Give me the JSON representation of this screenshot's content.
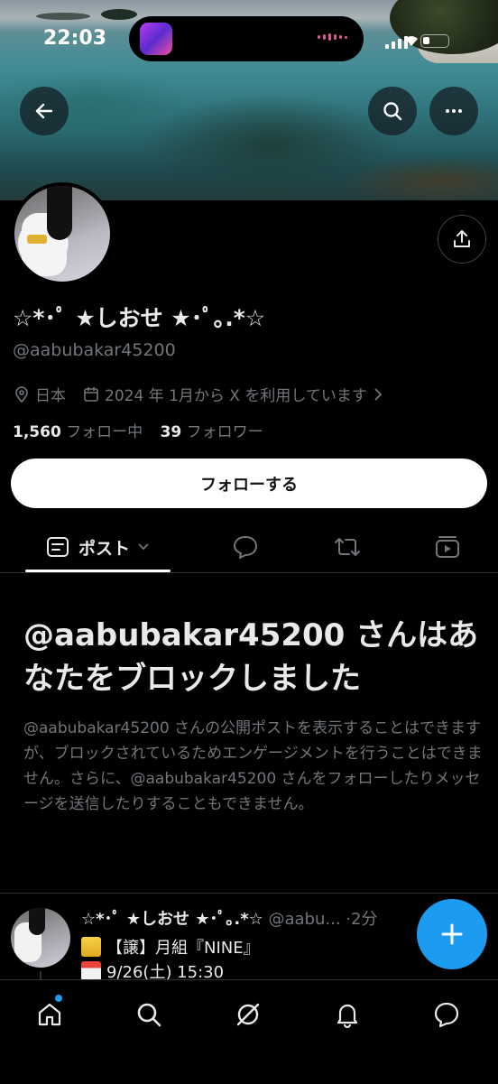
{
  "status_bar": {
    "time": "22:03"
  },
  "profile": {
    "display_name": "☆*･ﾟ ★しおせ ★･ﾟ｡.*☆",
    "handle": "@aabubakar45200",
    "location": "日本",
    "joined": "2024 年 1月から X を利用しています",
    "following_count": "1,560",
    "following_label": "フォロー中",
    "followers_count": "39",
    "followers_label": "フォロワー",
    "follow_button": "フォローする"
  },
  "tabs": [
    {
      "label": "ポスト",
      "icon": "posts-icon",
      "active": true
    },
    {
      "label": "",
      "icon": "reply-icon",
      "active": false
    },
    {
      "label": "",
      "icon": "repost-icon",
      "active": false
    },
    {
      "label": "",
      "icon": "media-icon",
      "active": false
    }
  ],
  "blocked": {
    "title": "@aabubakar45200 さんはあなたをブロックしました",
    "body": "@aabubakar45200 さんの公開ポストを表示することはできますが、ブロックされているためエンゲージメントを行うことはできません。さらに、@aabubakar45200 さんをフォローしたりメッセージを送信したりすることもできません。"
  },
  "post": {
    "author_name": "☆*･ﾟ ★しおせ ★･ﾟ｡.*☆",
    "author_handle": "@aabu...",
    "time": "·2分",
    "line1": "【譲】月組『NINE』",
    "line2": "9/26(土) 15:30"
  },
  "bottom_nav": [
    "home-icon",
    "search-icon",
    "grok-icon",
    "notifications-icon",
    "messages-icon"
  ],
  "colors": {
    "accent": "#1d9bf0",
    "text": "#e7e9ea",
    "muted": "#71767b",
    "background": "#000000"
  }
}
